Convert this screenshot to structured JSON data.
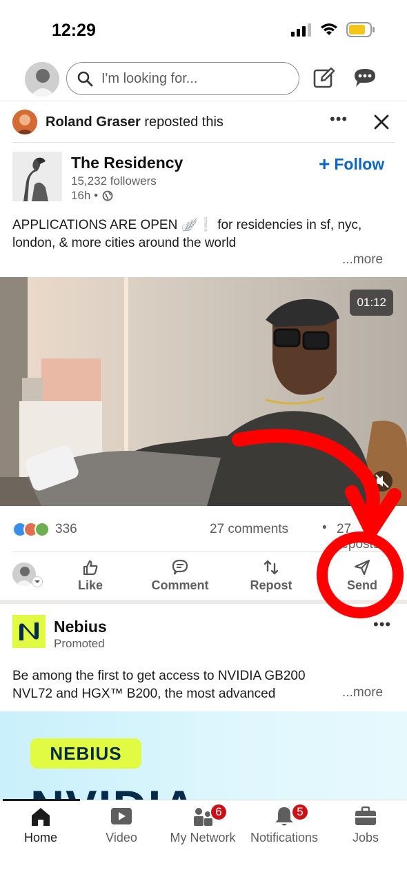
{
  "status_bar": {
    "time": "12:29"
  },
  "header": {
    "search_placeholder": "I'm looking for..."
  },
  "repost": {
    "name": "Roland Graser",
    "action": "reposted this"
  },
  "post": {
    "author": "The Residency",
    "followers": "15,232 followers",
    "time": "16h •",
    "follow_label": "Follow",
    "text": "APPLICATIONS ARE OPEN 🪽❕ for residencies in sf, nyc, london, & more cities around the world",
    "more_label": "...more",
    "video_duration": "01:12",
    "reaction_count": "336",
    "comments_count": "27 comments",
    "separator": "•",
    "reposts_count": "27 reposts"
  },
  "actions": [
    {
      "label": "Like",
      "icon": "thumbs-up-icon"
    },
    {
      "label": "Comment",
      "icon": "comment-icon"
    },
    {
      "label": "Repost",
      "icon": "repost-icon"
    },
    {
      "label": "Send",
      "icon": "send-icon"
    }
  ],
  "promoted": {
    "name": "Nebius",
    "sub": "Promoted",
    "text": "Be among the first to get access to NVIDIA GB200 NVL72 and HGX™ B200, the most advanced",
    "more_label": "...more",
    "badge": "NEBIUS",
    "headline": "NVIDIA"
  },
  "bottom_nav": [
    {
      "label": "Home",
      "icon": "home-icon",
      "active": true
    },
    {
      "label": "Video",
      "icon": "video-icon"
    },
    {
      "label": "My Network",
      "icon": "network-icon",
      "badge": "6"
    },
    {
      "label": "Notifications",
      "icon": "bell-icon",
      "badge": "5"
    },
    {
      "label": "Jobs",
      "icon": "briefcase-icon"
    }
  ],
  "colors": {
    "accent": "#0a66c2",
    "badge": "#cc1016",
    "annotation": "#ff0000",
    "nebius_yellow": "#e1fb43"
  }
}
